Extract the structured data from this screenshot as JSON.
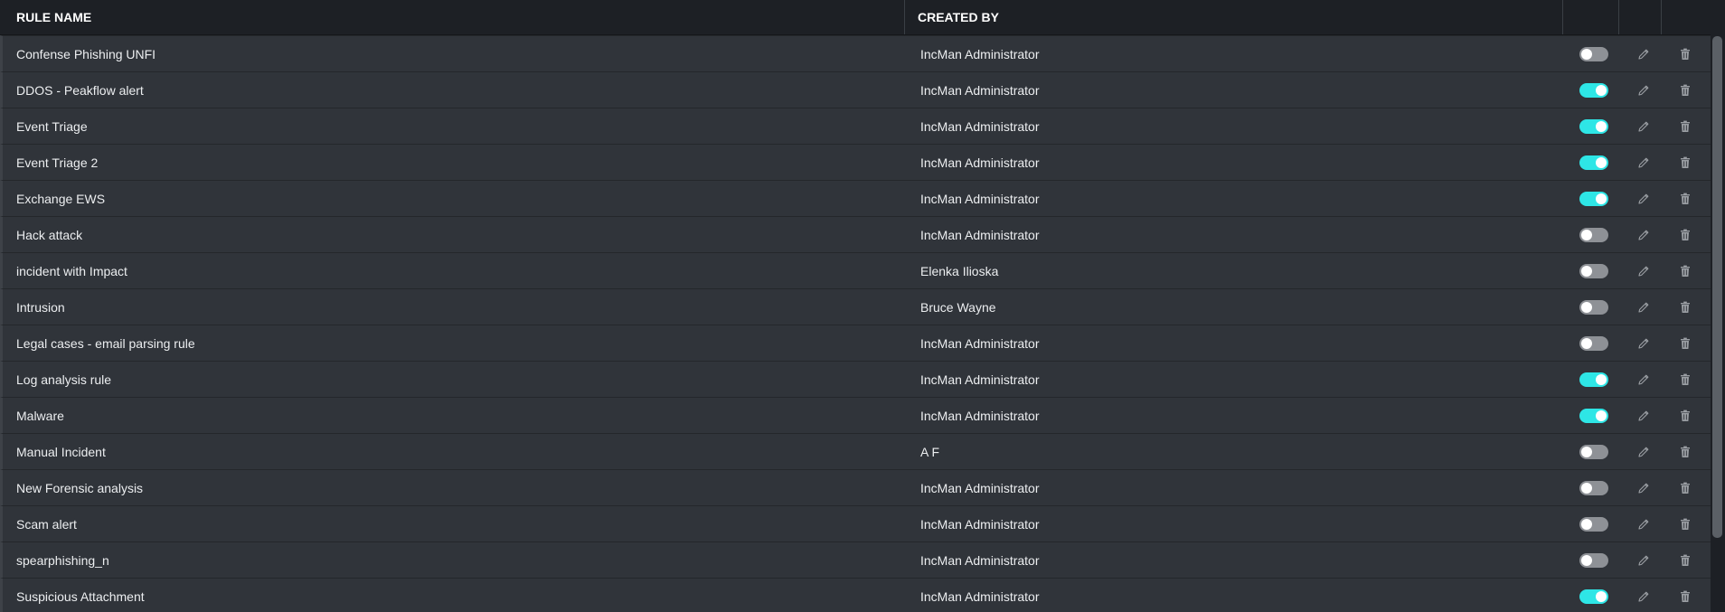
{
  "table": {
    "headers": {
      "rule_name": "RULE NAME",
      "created_by": "CREATED BY"
    },
    "rows": [
      {
        "name": "Confense Phishing UNFI",
        "creator": "IncMan Administrator",
        "enabled": false
      },
      {
        "name": "DDOS - Peakflow alert",
        "creator": "IncMan Administrator",
        "enabled": true
      },
      {
        "name": "Event Triage",
        "creator": "IncMan Administrator",
        "enabled": true
      },
      {
        "name": "Event Triage 2",
        "creator": "IncMan Administrator",
        "enabled": true
      },
      {
        "name": "Exchange EWS",
        "creator": "IncMan Administrator",
        "enabled": true
      },
      {
        "name": "Hack attack",
        "creator": "IncMan Administrator",
        "enabled": false
      },
      {
        "name": "incident with Impact",
        "creator": "Elenka Ilioska",
        "enabled": false
      },
      {
        "name": "Intrusion",
        "creator": "Bruce Wayne",
        "enabled": false
      },
      {
        "name": "Legal cases - email parsing rule",
        "creator": "IncMan Administrator",
        "enabled": false
      },
      {
        "name": "Log analysis rule",
        "creator": "IncMan Administrator",
        "enabled": true
      },
      {
        "name": "Malware",
        "creator": "IncMan Administrator",
        "enabled": true
      },
      {
        "name": "Manual Incident",
        "creator": "A F",
        "enabled": false
      },
      {
        "name": "New Forensic analysis",
        "creator": "IncMan Administrator",
        "enabled": false
      },
      {
        "name": "Scam alert",
        "creator": "IncMan Administrator",
        "enabled": false
      },
      {
        "name": "spearphishing_n",
        "creator": "IncMan Administrator",
        "enabled": false
      },
      {
        "name": "Suspicious Attachment",
        "creator": "IncMan Administrator",
        "enabled": true
      }
    ]
  },
  "icons": {
    "edit": "pencil-icon",
    "delete": "trash-icon"
  },
  "colors": {
    "toggle_on": "#2ee6e6",
    "toggle_off": "#8e9196",
    "header_bg": "#1d2025",
    "row_bg": "#30343a"
  }
}
